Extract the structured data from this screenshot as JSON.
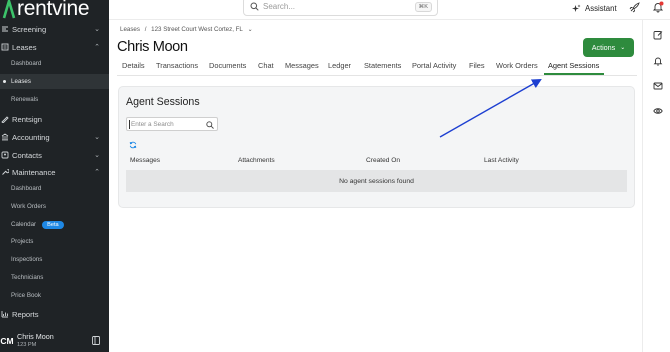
{
  "app": {
    "brand": "rentvine"
  },
  "sidebar": {
    "items": [
      {
        "label": "Screening",
        "icon": "screening-icon",
        "chevron": "down"
      },
      {
        "label": "Leases",
        "icon": "leases-icon",
        "chevron": "up"
      },
      {
        "label": "Rentsign",
        "icon": "rentsign-icon"
      },
      {
        "label": "Accounting",
        "icon": "accounting-icon",
        "chevron": "down"
      },
      {
        "label": "Contacts",
        "icon": "contacts-icon",
        "chevron": "down"
      },
      {
        "label": "Maintenance",
        "icon": "wrench-icon",
        "chevron": "up"
      },
      {
        "label": "Reports",
        "icon": "chart-icon"
      }
    ],
    "leases_sub": [
      "Dashboard",
      "Leases",
      "Renewals"
    ],
    "leases_active": "Leases",
    "maintenance_sub": [
      "Dashboard",
      "Work Orders",
      "Calendar",
      "Projects",
      "Inspections",
      "Technicians",
      "Price Book"
    ],
    "beta_badge": "Beta",
    "user": {
      "initials": "CM",
      "name": "Chris Moon",
      "time": "123 PM"
    }
  },
  "topbar": {
    "search_placeholder": "Search...",
    "shortcut": "⌘K",
    "assistant_label": "Assistant"
  },
  "breadcrumb": {
    "root": "Leases",
    "separator": "/",
    "current": "123 Street Court West Cortez, FL"
  },
  "page": {
    "title": "Chris Moon",
    "actions_label": "Actions"
  },
  "tabs": [
    "Details",
    "Transactions",
    "Documents",
    "Chat",
    "Messages",
    "Ledger",
    "Statements",
    "Portal Activity",
    "Files",
    "Work Orders",
    "Agent Sessions"
  ],
  "active_tab": "Agent Sessions",
  "panel": {
    "title": "Agent Sessions",
    "search_placeholder": "Enter a Search",
    "columns": [
      "Messages",
      "Attachments",
      "Created On",
      "Last Activity"
    ],
    "empty_text": "No agent sessions found"
  },
  "colors": {
    "sidebar_bg": "#1f2326",
    "accent_green": "#2e8b3d",
    "arrow_blue": "#1d3fd1",
    "beta_blue": "#1e88e5"
  }
}
